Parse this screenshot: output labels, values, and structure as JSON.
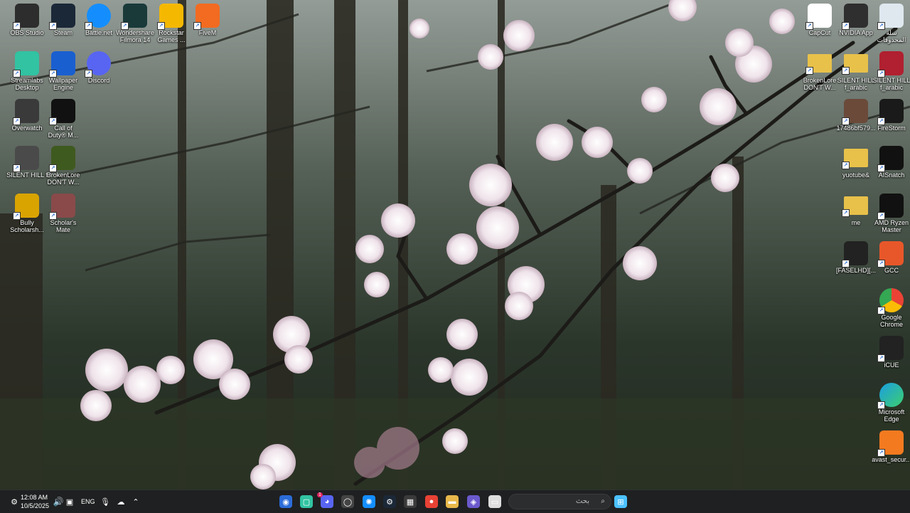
{
  "desktop": {
    "icons_left": [
      {
        "label": "OBS Studio",
        "icon": "obs-icon",
        "color": "#2d2d2d"
      },
      {
        "label": "Steam",
        "icon": "steam-icon",
        "color": "#1b2838"
      },
      {
        "label": "Battle.net",
        "icon": "battlenet-icon",
        "color": "#148eff"
      },
      {
        "label": "Wondershare\nFilmora 14",
        "icon": "filmora-icon",
        "color": "#1a3a3a"
      },
      {
        "label": "Rockstar\nGames ...",
        "icon": "rockstar-icon",
        "color": "#f5b800"
      },
      {
        "label": "FiveM",
        "icon": "fivem-icon",
        "color": "#f26b21"
      },
      {
        "label": "Streamlabs\nDesktop",
        "icon": "streamlabs-icon",
        "color": "#31c3a2"
      },
      {
        "label": "Wallpaper\nEngine",
        "icon": "wallpaper-engine-icon",
        "color": "#1a5fd0"
      },
      {
        "label": "Discord",
        "icon": "discord-icon",
        "color": "#5865f2"
      },
      {
        "label": "Overwatch",
        "icon": "overwatch-icon",
        "color": "#3a3a3a"
      },
      {
        "label": "Call of\nDuty® M...",
        "icon": "call-of-duty-icon",
        "color": "#111111"
      },
      {
        "label": "SILENT HILL f",
        "icon": "silent-hill-icon",
        "color": "#4a4a4a"
      },
      {
        "label": "BrokenLore\nDON'T W...",
        "icon": "brokenlore-icon",
        "color": "#3f5a1f"
      },
      {
        "label": "Bully\nScholarsh...",
        "icon": "bully-icon",
        "color": "#d9a400"
      },
      {
        "label": "Scholar's\nMate",
        "icon": "scholars-mate-icon",
        "color": "#8a4a4a"
      }
    ],
    "icons_right": [
      {
        "label": "CapCut",
        "icon": "capcut-icon",
        "color": "#ffffff"
      },
      {
        "label": "NVIDIA App",
        "icon": "nvidia-icon",
        "color": "#2f2f2f"
      },
      {
        "label": "سلة\nالمحذوفات",
        "icon": "recycle-bin-icon",
        "color": "#dfe8ef"
      },
      {
        "label": "BrokenLore\nDON'T W...",
        "icon": "folder-icon",
        "color": "#e8c14a"
      },
      {
        "label": "SILENT HILL\nf_arabic",
        "icon": "folder-icon",
        "color": "#e8c14a"
      },
      {
        "label": "SILENT HILL\nf_arabic",
        "icon": "game-icon",
        "color": "#b02030"
      },
      {
        "label": "17486bf579...",
        "icon": "image-file-icon",
        "color": "#6b4a3a"
      },
      {
        "label": "FireStorm",
        "icon": "firestorm-icon",
        "color": "#1a1a1a"
      },
      {
        "label": "yuotube&",
        "icon": "folder-icon",
        "color": "#e8c14a"
      },
      {
        "label": "AISnatch",
        "icon": "aisnatch-icon",
        "color": "#111111"
      },
      {
        "label": "me",
        "icon": "folder-icon",
        "color": "#e8c14a"
      },
      {
        "label": "AMD Ryzen\nMaster",
        "icon": "amd-ryzen-icon",
        "color": "#111111"
      },
      {
        "label": "[FASELHD][...",
        "icon": "video-file-icon",
        "color": "#222222"
      },
      {
        "label": "GCC",
        "icon": "gcc-icon",
        "color": "#e8572a"
      },
      {
        "label": "Google\nChrome",
        "icon": "chrome-icon",
        "color": "#ffffff"
      },
      {
        "label": "iCUE",
        "icon": "icue-icon",
        "color": "#222222"
      },
      {
        "label": "Microsoft\nEdge",
        "icon": "edge-icon",
        "color": "#1b9de2"
      },
      {
        "label": "avast_secur...",
        "icon": "avast-icon",
        "color": "#f47a20"
      }
    ]
  },
  "taskbar": {
    "time": "12:08 AM",
    "date": "10/5/2025",
    "language": "ENG",
    "search_placeholder": "بحث",
    "discord_badge": "1",
    "apps": [
      {
        "name": "copilot-icon",
        "color": "#2b6cd8"
      },
      {
        "name": "streamlabs-icon",
        "color": "#31c3a2"
      },
      {
        "name": "discord-icon",
        "color": "#5865f2"
      },
      {
        "name": "overwatch-icon",
        "color": "#444444"
      },
      {
        "name": "battlenet-icon",
        "color": "#148eff"
      },
      {
        "name": "steam-icon",
        "color": "#1b2838"
      },
      {
        "name": "store-icon",
        "color": "#3a3a3a"
      },
      {
        "name": "chrome-icon",
        "color": "#e94235"
      },
      {
        "name": "file-explorer-icon",
        "color": "#e8b84a"
      },
      {
        "name": "capcut-icon",
        "color": "#6a5acd"
      },
      {
        "name": "task-view-icon",
        "color": "#dddddd"
      },
      {
        "name": "windows-start-icon",
        "color": "#4cc2ff"
      }
    ]
  }
}
